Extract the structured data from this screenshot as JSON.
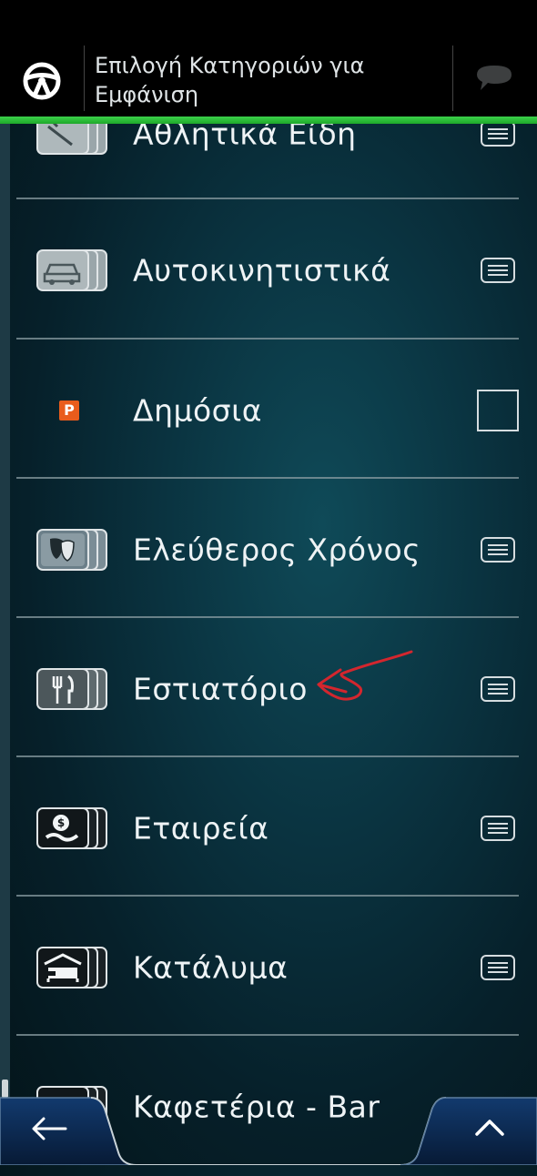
{
  "header": {
    "title": "Επιλογή Κατηγοριών για Εμφάνιση",
    "left_icon": "steering-wheel-icon",
    "right_icon": "chat-bubble-icon",
    "accent_color": "#2fc23d"
  },
  "categories": [
    {
      "label": "Αθλητικά Είδη",
      "icon": "sports-icon",
      "control": "menu"
    },
    {
      "label": "Αυτοκινητιστικά",
      "icon": "car-icon",
      "control": "menu"
    },
    {
      "label": "Δημόσια",
      "icon": "parking-icon",
      "icon_text": "P",
      "control": "checkbox",
      "checked": false
    },
    {
      "label": "Ελεύθερος Χρόνος",
      "icon": "theater-masks-icon",
      "control": "menu"
    },
    {
      "label": "Εστιατόριο",
      "icon": "fork-knife-icon",
      "control": "menu"
    },
    {
      "label": "Εταιρεία",
      "icon": "company-icon",
      "control": "menu"
    },
    {
      "label": "Κατάλυμα",
      "icon": "bed-icon",
      "control": "menu"
    },
    {
      "label": "Καφετέρια - Bar",
      "icon": "coffee-icon",
      "control": "menu"
    }
  ],
  "footer": {
    "back_icon": "arrow-left-icon",
    "up_icon": "chevron-up-icon"
  }
}
